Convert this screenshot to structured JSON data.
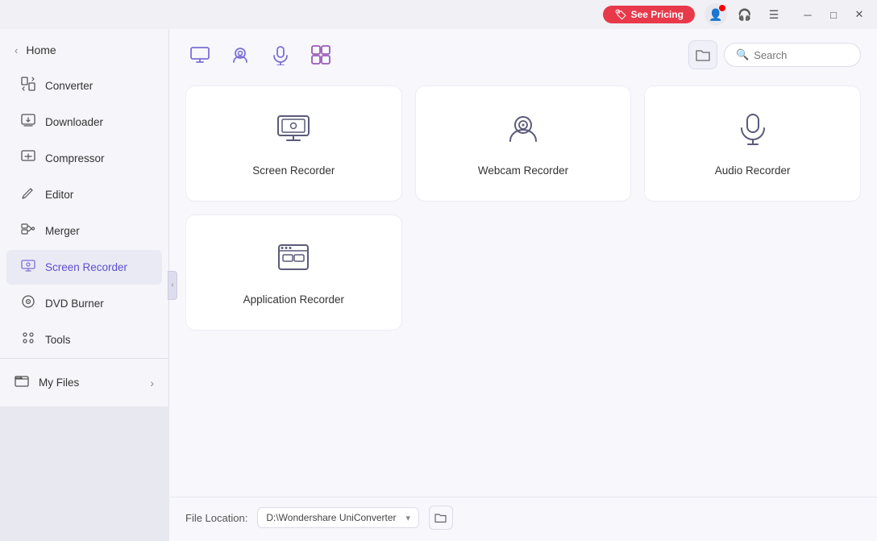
{
  "titleBar": {
    "seePricing": "See Pricing",
    "tagIcon": "🏷",
    "menuIcon": "☰",
    "minIcon": "─",
    "maxIcon": "□",
    "closeIcon": "✕"
  },
  "sidebar": {
    "homeLabel": "Home",
    "collapseIcon": "‹",
    "items": [
      {
        "id": "converter",
        "label": "Converter",
        "icon": "converter"
      },
      {
        "id": "downloader",
        "label": "Downloader",
        "icon": "downloader"
      },
      {
        "id": "compressor",
        "label": "Compressor",
        "icon": "compressor"
      },
      {
        "id": "editor",
        "label": "Editor",
        "icon": "editor"
      },
      {
        "id": "merger",
        "label": "Merger",
        "icon": "merger"
      },
      {
        "id": "screen-recorder",
        "label": "Screen Recorder",
        "icon": "screen-recorder",
        "active": true
      },
      {
        "id": "dvd-burner",
        "label": "DVD Burner",
        "icon": "dvd-burner"
      },
      {
        "id": "tools",
        "label": "Tools",
        "icon": "tools"
      }
    ],
    "myFiles": "My Files",
    "myFilesChevron": "›"
  },
  "toolbar": {
    "searchPlaceholder": "Search",
    "folderIcon": "📁"
  },
  "cards": {
    "row1": [
      {
        "id": "screen-recorder",
        "label": "Screen Recorder"
      },
      {
        "id": "webcam-recorder",
        "label": "Webcam Recorder"
      },
      {
        "id": "audio-recorder",
        "label": "Audio Recorder"
      }
    ],
    "row2": [
      {
        "id": "application-recorder",
        "label": "Application Recorder"
      }
    ]
  },
  "footer": {
    "fileLocationLabel": "File Location:",
    "fileLocationPath": "D:\\Wondershare UniConverter",
    "chevron": "▾"
  }
}
